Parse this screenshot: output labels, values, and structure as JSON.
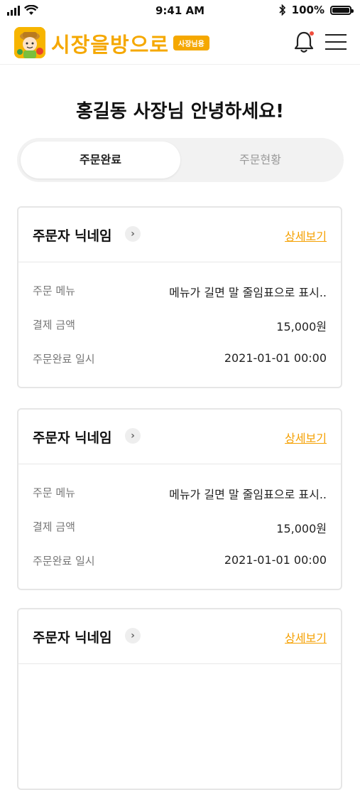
{
  "status_bar": {
    "time": "9:41 AM",
    "battery": "100%"
  },
  "header": {
    "logo_text": "시장을방으로",
    "logo_tag": "사장님용",
    "bell_icon": "bell-icon",
    "menu_icon": "hamburger-icon",
    "accent": "#f5a800"
  },
  "greeting": "홍길동 사장님 안녕하세요!",
  "tabs": [
    {
      "label": "주문완료",
      "active": true
    },
    {
      "label": "주문현황",
      "active": false
    }
  ],
  "orders": [
    {
      "nickname": "주문자 닉네임",
      "detail_link": "상세보기",
      "fields": [
        {
          "label": "주문 메뉴",
          "value": "메뉴가 길면 말 줄임표으로 표시.."
        },
        {
          "label": "결제 금액",
          "value": "15,000원"
        },
        {
          "label": "주문완료 일시",
          "value": "2021-01-01 00:00"
        }
      ]
    },
    {
      "nickname": "주문자 닉네임",
      "detail_link": "상세보기",
      "fields": [
        {
          "label": "주문 메뉴",
          "value": "메뉴가 길면 말 줄임표으로 표시.."
        },
        {
          "label": "결제 금액",
          "value": "15,000원"
        },
        {
          "label": "주문완료 일시",
          "value": "2021-01-01 00:00"
        }
      ]
    },
    {
      "nickname": "주문자 닉네임",
      "detail_link": "상세보기",
      "fields": []
    }
  ]
}
